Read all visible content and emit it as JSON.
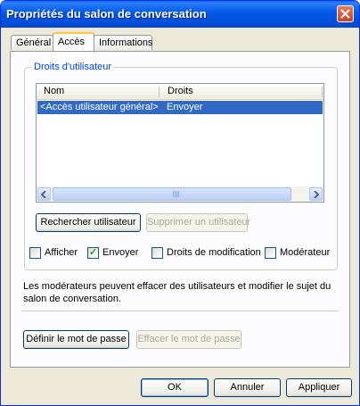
{
  "window": {
    "title": "Propriétés du salon de conversation"
  },
  "tabs": [
    {
      "label": "Général"
    },
    {
      "label": "Accès"
    },
    {
      "label": "Informations"
    }
  ],
  "group": {
    "label": "Droits d'utilisateur"
  },
  "listview": {
    "columns": [
      "Nom",
      "Droits"
    ],
    "rows": [
      {
        "name": "<Accès utilisateur général>",
        "rights": "Envoyer",
        "selected": true
      }
    ]
  },
  "buttons": {
    "find_user": "Rechercher utilisateur",
    "remove_user": "Supprimer un utilisateur",
    "set_password": "Définir le mot de passe",
    "clear_password": "Effacer le mot de passe",
    "ok": "OK",
    "cancel": "Annuler",
    "apply": "Appliquer"
  },
  "checkboxes": [
    {
      "label": "Afficher",
      "checked": false
    },
    {
      "label": "Envoyer",
      "checked": true
    },
    {
      "label": "Droits de modification",
      "checked": false
    },
    {
      "label": "Modérateur",
      "checked": false
    }
  ],
  "description": "Les modérateurs peuvent effacer des utilisateurs et modifier le sujet du salon de conversation.",
  "colors": {
    "titlebar": "#0058e6",
    "selection": "#316ac5",
    "group_label": "#0046d5",
    "close": "#c7421f"
  }
}
